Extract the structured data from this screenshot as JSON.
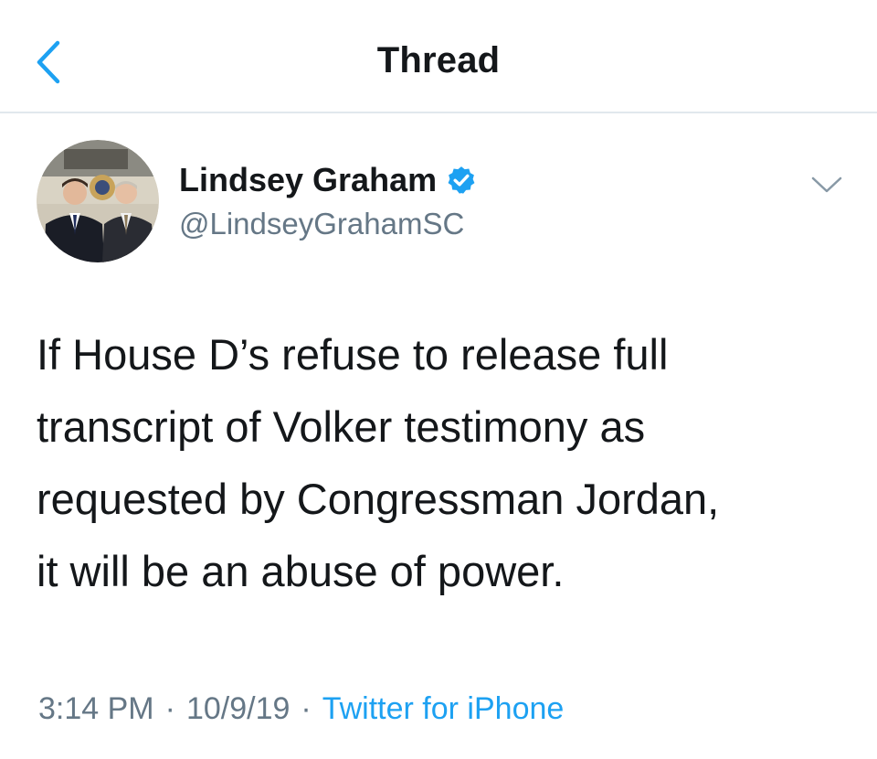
{
  "header": {
    "title": "Thread",
    "back_icon": "chevron-left-icon",
    "accent": "#1da1f2"
  },
  "tweet": {
    "author": {
      "name": "Lindsey Graham",
      "handle": "@LindseyGrahamSC",
      "verified": true,
      "verified_color": "#1da1f2"
    },
    "menu_icon": "chevron-down-icon",
    "text": "If House D’s refuse to release full\ntranscript of Volker testimony as\nrequested by Congressman Jordan,\nit will be an abuse of power.",
    "time": "3:14 PM",
    "date": "10/9/19",
    "separator": "·",
    "source": "Twitter for iPhone"
  }
}
